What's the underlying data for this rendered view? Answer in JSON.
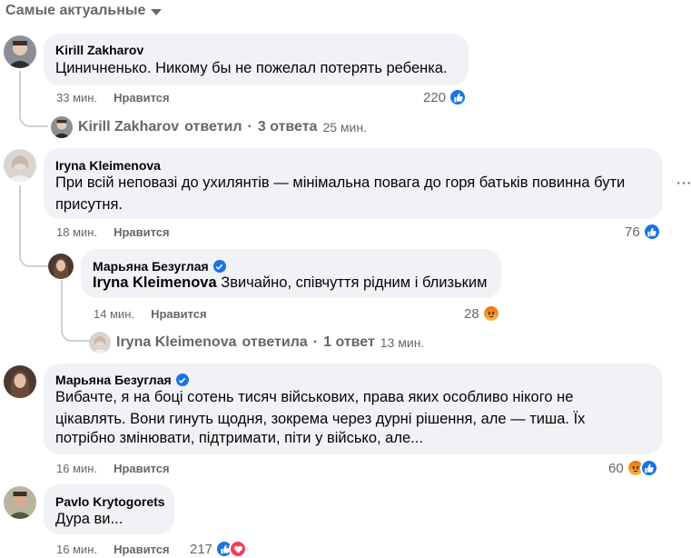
{
  "sort": {
    "label": "Самые актуальные"
  },
  "comments": [
    {
      "author": "Kirill Zakharov",
      "text": "Циничненько. Никому бы не пожелал потерять ребенка.",
      "time": "33 мин.",
      "like_label": "Нравится",
      "count": "220",
      "replies": {
        "author": "Kirill Zakharov",
        "action": "ответил",
        "sep": "·",
        "count": "3 ответа",
        "time": "25 мин."
      }
    },
    {
      "author": "Iryna Kleimenova",
      "text_line1": "При всій неповазі до ухилянтів — мінімальна повага до горя батьків повинна бути",
      "text_line2": "присутня.",
      "time": "18 мин.",
      "like_label": "Нравится",
      "count": "76",
      "more": "···",
      "reply": {
        "author": "Марьяна Безуглая",
        "mention": "Iryna Kleimenova",
        "text": " Звичайно, співчуття рідним і близьким",
        "time": "14 мин.",
        "like_label": "Нравится",
        "count": "28",
        "replies": {
          "author": "Iryna Kleimenova",
          "action": "ответила",
          "sep": "·",
          "count": "1 ответ",
          "time": "13 мин."
        }
      }
    },
    {
      "author": "Марьяна Безуглая",
      "text_line1": "Вибачте, я на боці сотень тисяч військових, права яких особливо нікого не",
      "text_line2": "цікавлять. Вони гинуть щодня, зокрема через дурні рішення, але — тиша. Їх",
      "text_line3": "потрібно змінювати, підтримати, піти у військо, але...",
      "time": "16 мин.",
      "like_label": "Нравится",
      "count": "60"
    },
    {
      "author": "Pavlo Krytogorets",
      "text": "Дура ви...",
      "time": "16 мин.",
      "like_label": "Нравится",
      "count": "217"
    }
  ],
  "icons": {
    "like": "thumbs-up-icon",
    "angry": "angry-face-icon",
    "love": "heart-icon",
    "verified": "verified-badge-icon",
    "sort": "caret-down-icon"
  },
  "colors": {
    "like_blue": "#1b74e4",
    "angry_orange": "#e9710f",
    "love_red": "#f33e58",
    "bubble": "#f0f2f5",
    "muted": "#65676b"
  }
}
